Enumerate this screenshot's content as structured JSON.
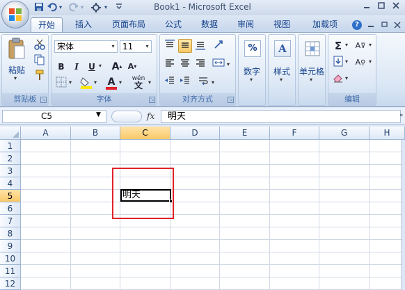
{
  "window": {
    "title": "Book1 - Microsoft Excel"
  },
  "quick_access": {
    "undo_arrow": "▾",
    "redo_arrow": "▾",
    "customize": "▾"
  },
  "tabs": [
    "开始",
    "插入",
    "页面布局",
    "公式",
    "数据",
    "审阅",
    "视图",
    "加载项"
  ],
  "ribbon": {
    "clipboard": {
      "label": "剪贴板",
      "paste_label": "粘贴"
    },
    "font": {
      "label": "字体",
      "font_name": "宋体",
      "font_size": "11",
      "bold": "B",
      "italic": "I",
      "underline": "U",
      "grow": "A",
      "shrink": "A",
      "font_color_letter": "A",
      "phonetic": "wén"
    },
    "alignment": {
      "label": "对齐方式"
    },
    "number": {
      "label": "数字",
      "icon_text": "%"
    },
    "styles": {
      "label": "样式",
      "icon_text": "A"
    },
    "cells": {
      "label": "单元格"
    },
    "editing": {
      "label": "编辑",
      "sum_icon": "Σ",
      "sort_icon": "A",
      "find_icon": "A"
    }
  },
  "formula_bar": {
    "name_box": "C5",
    "fx_label": "fx",
    "content": "明天"
  },
  "grid": {
    "columns": [
      "A",
      "B",
      "C",
      "D",
      "E",
      "F",
      "G",
      "H"
    ],
    "rows": [
      "1",
      "2",
      "3",
      "4",
      "5",
      "6",
      "7",
      "8",
      "9",
      "10",
      "11",
      "12"
    ],
    "selected_column": "C",
    "selected_row": "5",
    "active_cell_value": "明天"
  },
  "colors": {
    "selection_box": "#e0222a",
    "header_highlight": "#f9c869"
  }
}
